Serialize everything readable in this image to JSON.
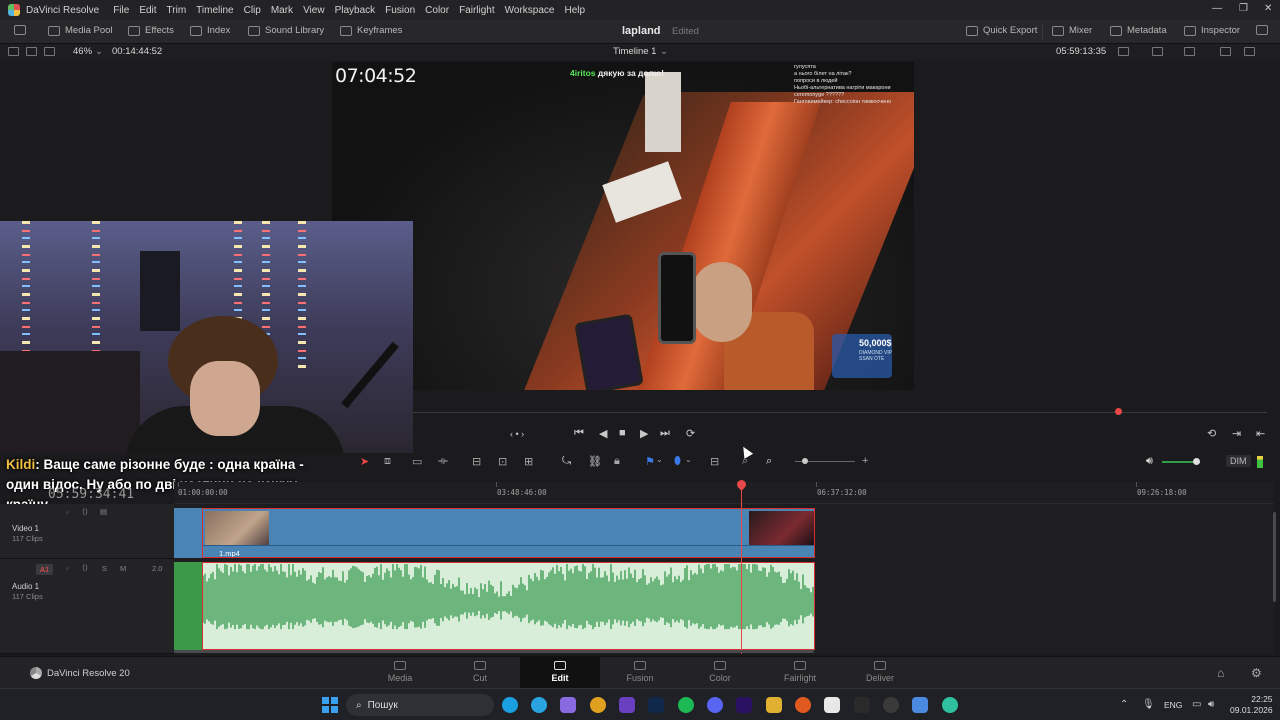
{
  "menubar": {
    "app_name": "DaVinci Resolve",
    "items": [
      "File",
      "Edit",
      "Trim",
      "Timeline",
      "Clip",
      "Mark",
      "View",
      "Playback",
      "Fusion",
      "Color",
      "Fairlight",
      "Workspace",
      "Help"
    ],
    "window_controls": [
      "—",
      "❐",
      "✕"
    ]
  },
  "toolbar": {
    "media_pool": "Media Pool",
    "effects": "Effects",
    "index": "Index",
    "sound_library": "Sound Library",
    "keyframes": "Keyframes",
    "project_title": "lapland",
    "project_status": "Edited",
    "quick_export": "Quick Export",
    "mixer": "Mixer",
    "metadata": "Metadata",
    "inspector": "Inspector"
  },
  "viewer_bar": {
    "zoom": "46%",
    "source_timecode": "00:14:44:52",
    "timeline_name": "Timeline 1",
    "record_timecode": "05:59:13:35"
  },
  "viewer": {
    "stream_timer": "07:04:52",
    "chat_username": "4iritos",
    "chat_message": " дякую за долю!",
    "chat_box_lines": [
      "гулусята",
      "а нього білет на літак?",
      "попроси в людей",
      "Ньобі-альтернатива нагріти макарони",
      "ceremonyge ??????",
      "Ганговимейкер: сhессоіон тимкосчено"
    ],
    "donation_amount": "50,000$",
    "donation_sub": "DIAMOND VIP SSAN OTE"
  },
  "subtitle": {
    "name": "Kildi",
    "text": ": Ваще саме різонне буде : одна країна - один відос. Ну або по дві частини на кожну країну"
  },
  "transport": {
    "buttons": [
      "‹ • ›",
      "⏮",
      "◀",
      "■",
      "▶",
      "⏭",
      "⟳"
    ],
    "right_buttons": [
      "⟲",
      "⇥",
      "⇤"
    ]
  },
  "timeline": {
    "current_timecode": "05:59:34:41",
    "ruler_labels": [
      "01:00:00:00",
      "03:48:46:00",
      "06:37:32:00",
      "09:26:18:00"
    ],
    "dim_label": "DIM",
    "video_track": {
      "name": "Video 1",
      "clips": "117 Clips",
      "clip_name": "1.mp4"
    },
    "audio_track": {
      "id": "A1",
      "name": "Audio 1",
      "clips": "117 Clips",
      "solo": "S",
      "mute": "M",
      "channel": "2.0"
    },
    "playhead_fraction": 0.924,
    "volume_fraction": 0.8
  },
  "pages": {
    "brand": "DaVinci Resolve 20",
    "tabs": [
      "Media",
      "Cut",
      "Edit",
      "Fusion",
      "Color",
      "Fairlight",
      "Deliver"
    ],
    "active": "Edit"
  },
  "taskbar": {
    "search_placeholder": "Пошук",
    "language": "ENG",
    "time": "22:25",
    "date": "09.01.2026"
  },
  "colors": {
    "accent": "#e84848",
    "video_clip": "#4a84b4",
    "audio_clip": "#d8eed8",
    "waveform": "#3e9e58"
  }
}
